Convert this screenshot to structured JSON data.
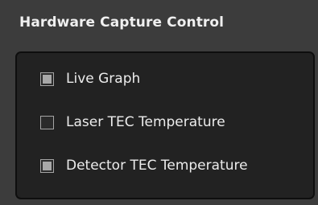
{
  "panel": {
    "title": "Hardware Capture Control"
  },
  "options": [
    {
      "label": "Live Graph",
      "state": "indeterminate"
    },
    {
      "label": "Laser TEC Temperature",
      "state": "unchecked"
    },
    {
      "label": "Detector TEC Temperature",
      "state": "indeterminate"
    }
  ]
}
